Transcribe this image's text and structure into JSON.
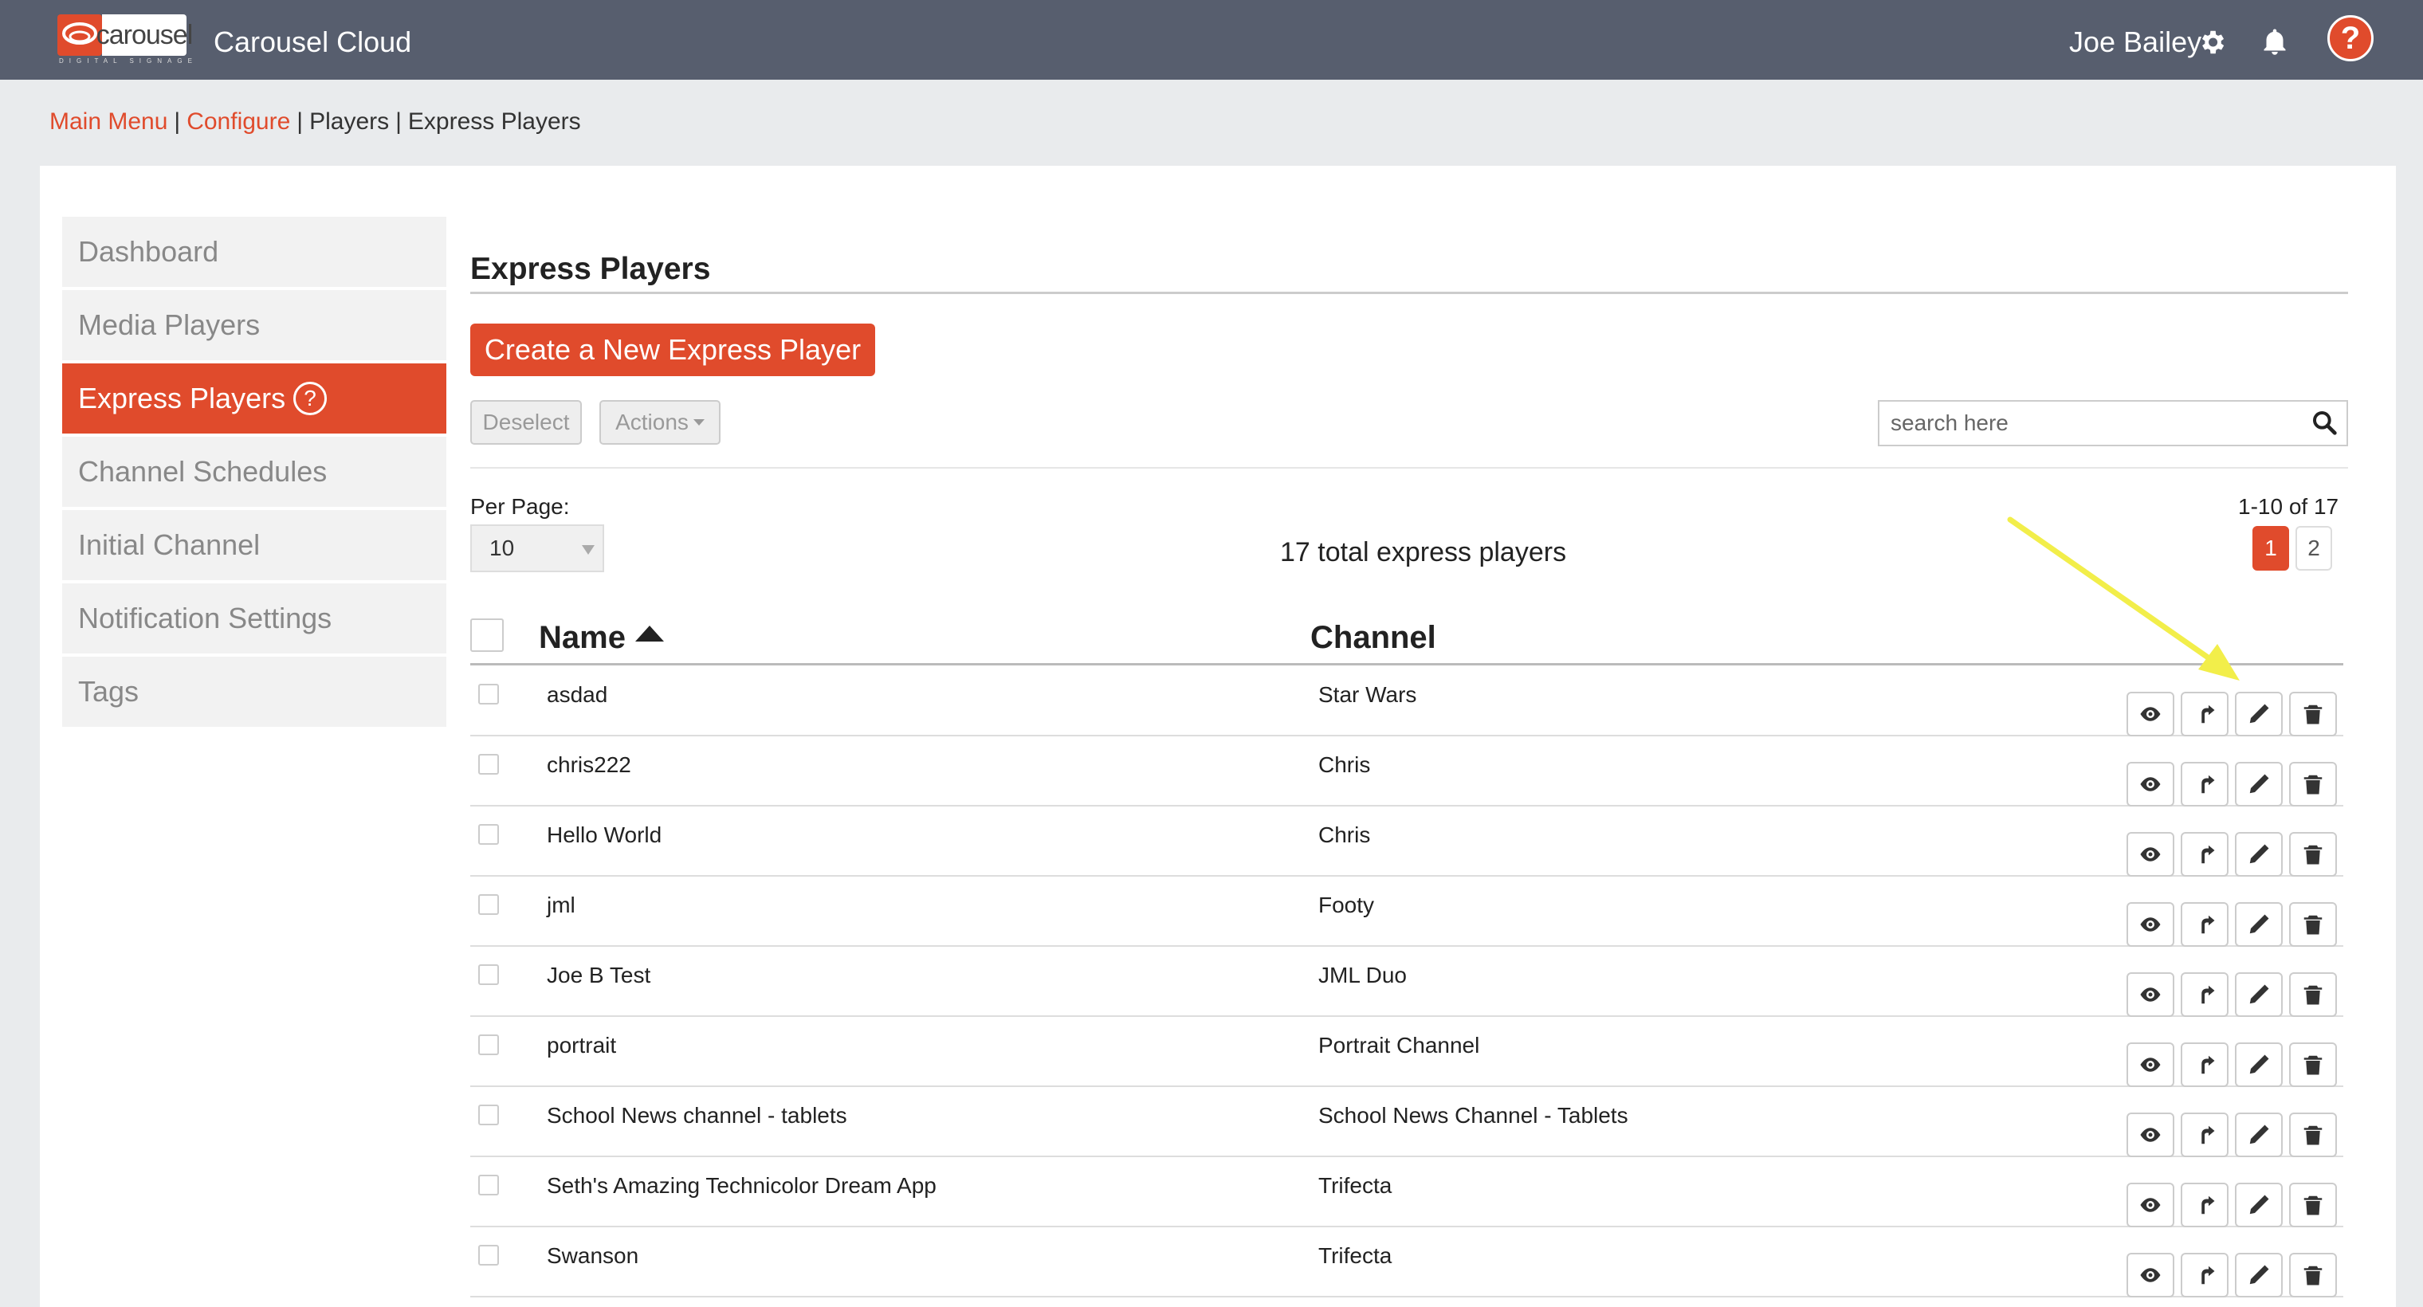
{
  "header": {
    "logo_text": "carousel",
    "logo_subtext": "DIGITAL SIGNAGE",
    "app_title": "Carousel Cloud",
    "user_name": "Joe Bailey",
    "help_label": "?"
  },
  "breadcrumb": {
    "items": [
      "Main Menu",
      "Configure",
      "Players",
      "Express Players"
    ],
    "separator": "|"
  },
  "sidebar": {
    "items": [
      {
        "label": "Dashboard"
      },
      {
        "label": "Media Players"
      },
      {
        "label": "Express Players",
        "active": true,
        "help": "?"
      },
      {
        "label": "Channel Schedules"
      },
      {
        "label": "Initial Channel"
      },
      {
        "label": "Notification Settings"
      },
      {
        "label": "Tags"
      }
    ]
  },
  "main": {
    "title": "Express Players",
    "create_button": "Create a New Express Player",
    "deselect_button": "Deselect",
    "actions_button": "Actions",
    "search_placeholder": "search here",
    "per_page_label": "Per Page:",
    "per_page_value": "10",
    "total_text": "17 total express players",
    "range_text": "1-10 of 17",
    "pages": [
      "1",
      "2"
    ],
    "current_page": "1"
  },
  "table": {
    "columns": [
      "Name",
      "Channel"
    ],
    "sort_column": "Name",
    "sort_direction": "ascending",
    "rows": [
      {
        "name": "asdad",
        "channel": "Star Wars"
      },
      {
        "name": "chris222",
        "channel": "Chris"
      },
      {
        "name": "Hello World",
        "channel": "Chris"
      },
      {
        "name": "jml",
        "channel": "Footy"
      },
      {
        "name": "Joe B Test",
        "channel": "JML Duo"
      },
      {
        "name": "portrait",
        "channel": "Portrait Channel"
      },
      {
        "name": "School News channel - tablets",
        "channel": "School News Channel - Tablets"
      },
      {
        "name": "Seth's Amazing Technicolor Dream App",
        "channel": "Trifecta"
      },
      {
        "name": "Swanson",
        "channel": "Trifecta"
      }
    ],
    "row_actions": [
      "eye-icon",
      "push-icon",
      "pencil-icon",
      "trash-icon"
    ]
  },
  "colors": {
    "accent": "#e04b2c",
    "topbar": "#575e6e",
    "annotation": "#f2ee4a"
  }
}
